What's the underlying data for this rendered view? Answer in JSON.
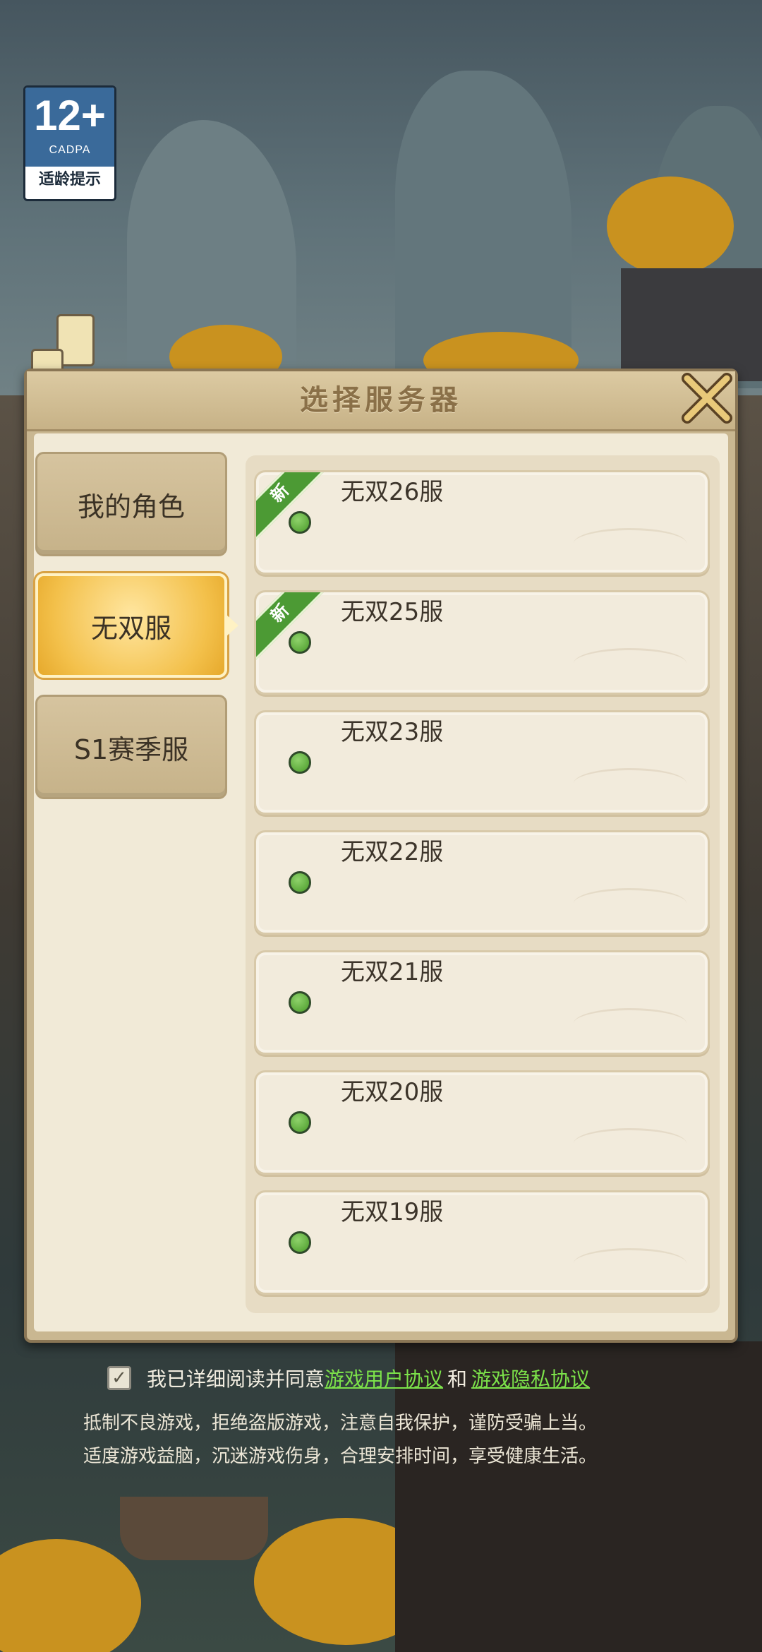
{
  "age_badge": {
    "rating": "12+",
    "org": "CADPA",
    "hint": "适龄提示"
  },
  "dialog": {
    "title": "选择服务器",
    "close_icon": "close-x-icon"
  },
  "tabs": [
    {
      "label": "我的角色",
      "active": false
    },
    {
      "label": "无双服",
      "active": true
    },
    {
      "label": "S1赛季服",
      "active": false
    }
  ],
  "servers": [
    {
      "name": "无双26服",
      "new_tag": "新",
      "status": "online"
    },
    {
      "name": "无双25服",
      "new_tag": "新",
      "status": "online"
    },
    {
      "name": "无双23服",
      "new_tag": "",
      "status": "online"
    },
    {
      "name": "无双22服",
      "new_tag": "",
      "status": "online"
    },
    {
      "name": "无双21服",
      "new_tag": "",
      "status": "online"
    },
    {
      "name": "无双20服",
      "new_tag": "",
      "status": "online"
    },
    {
      "name": "无双19服",
      "new_tag": "",
      "status": "online"
    }
  ],
  "agreement": {
    "checked_mark": "✓",
    "text_before": "我已详细阅读并同意",
    "link1": "游戏用户协议",
    "and": "和",
    "link2": "游戏隐私协议"
  },
  "notice": {
    "line1": "抵制不良游戏，拒绝盗版游戏，注意自我保护，谨防受骗上当。",
    "line2": "适度游戏益脑，沉迷游戏伤身，合理安排时间，享受健康生活。"
  },
  "colors": {
    "status_online": "#5aa83a",
    "link": "#7ce24a",
    "new_ribbon": "#4c9a34",
    "active_tab": "#f3c04a"
  }
}
